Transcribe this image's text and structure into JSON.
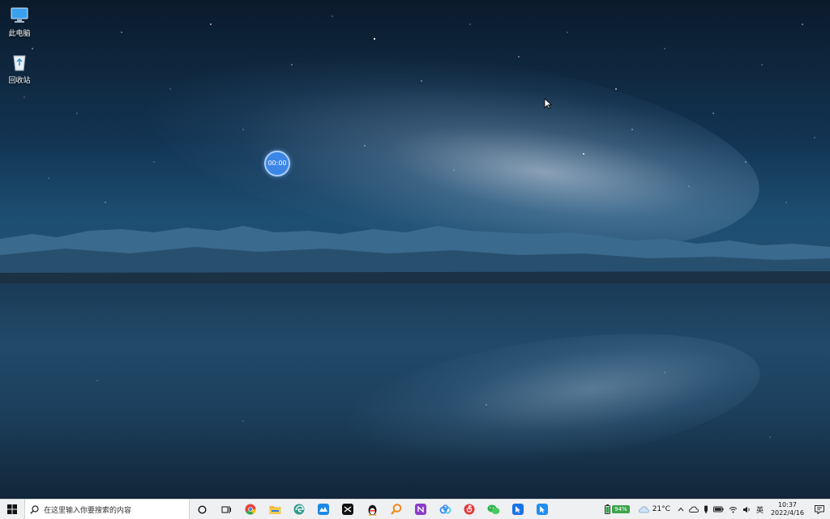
{
  "desktop": {
    "icons": [
      {
        "label": "此电脑",
        "icon": "computer-icon"
      },
      {
        "label": "回收站",
        "icon": "recycle-bin-icon"
      }
    ],
    "timer_widget": {
      "time": "00:00"
    }
  },
  "taskbar": {
    "search_placeholder": "在这里输入你要搜索的内容",
    "apps": [
      {
        "name": "cortana",
        "icon": "cortana-circle-icon"
      },
      {
        "name": "task-view",
        "icon": "task-view-icon"
      },
      {
        "name": "chrome",
        "icon": "chrome-icon",
        "color": "#e8453c"
      },
      {
        "name": "file-explorer",
        "icon": "folder-icon",
        "color": "#f2b632"
      },
      {
        "name": "edge",
        "icon": "edge-icon",
        "color": "#2f9a8c"
      },
      {
        "name": "app-blue",
        "icon": "blue-app-icon",
        "color": "#1e88e5"
      },
      {
        "name": "capcut",
        "icon": "capcut-icon",
        "color": "#111111"
      },
      {
        "name": "qq",
        "icon": "qq-penguin-icon",
        "color": "#111111"
      },
      {
        "name": "search-tool",
        "icon": "magnifier-app-icon",
        "color": "#f08a1c"
      },
      {
        "name": "onenote",
        "icon": "onenote-icon",
        "color": "#8b3cc8"
      },
      {
        "name": "baidu-netdisk",
        "icon": "cloud-drive-icon",
        "color": "#2d7cf6"
      },
      {
        "name": "netease-music",
        "icon": "music-icon",
        "color": "#e03a3a"
      },
      {
        "name": "wechat",
        "icon": "wechat-icon",
        "color": "#2ab34a"
      },
      {
        "name": "feishu",
        "icon": "feishu-icon",
        "color": "#1a73e8"
      },
      {
        "name": "dingtalk",
        "icon": "dingtalk-icon",
        "color": "#1f8ef1"
      }
    ]
  },
  "tray": {
    "battery_percent": "94%",
    "weather": "21°C",
    "ime": "英",
    "time": "10:37",
    "date": "2022/4/16"
  }
}
